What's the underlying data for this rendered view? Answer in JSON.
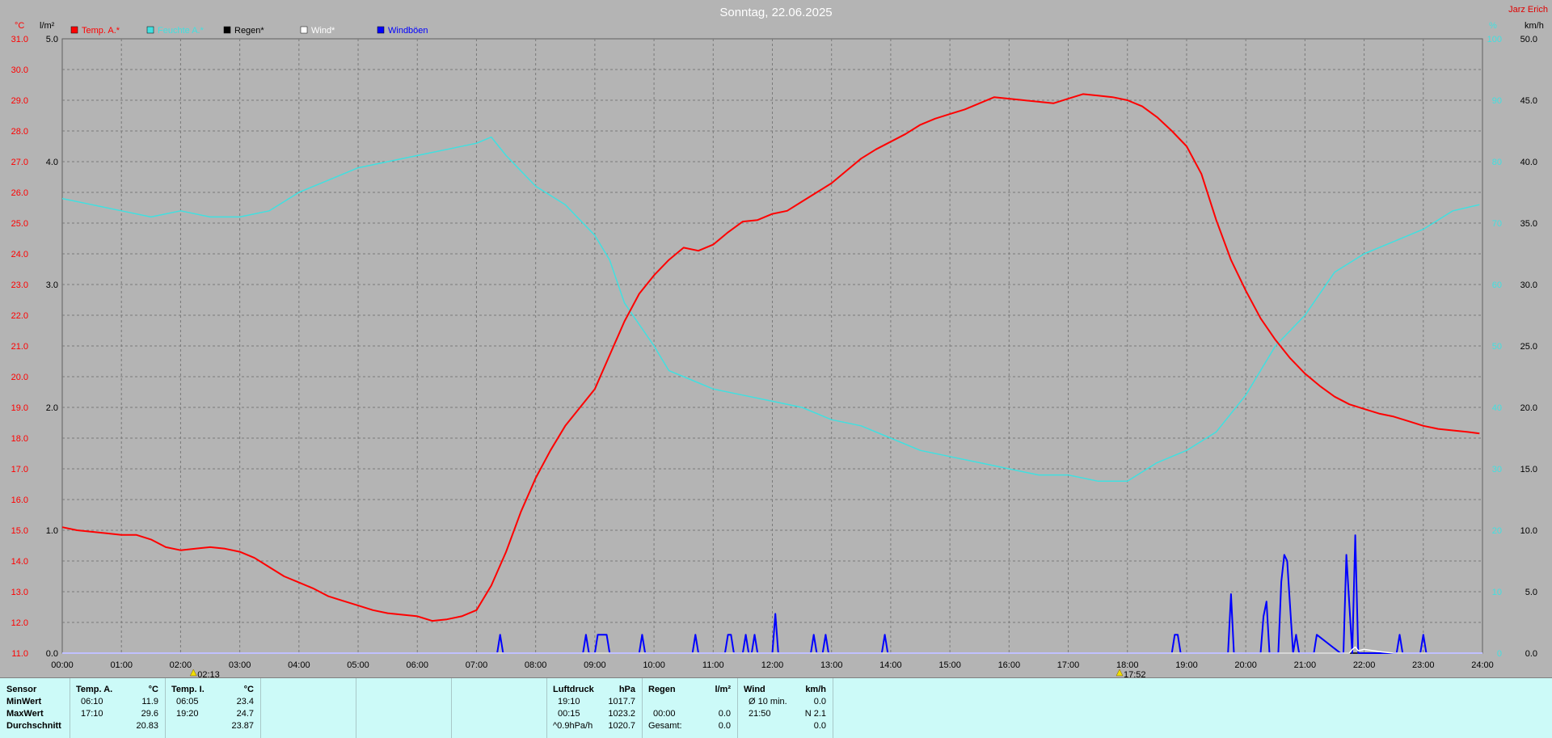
{
  "header": {
    "title": "Sonntag, 22.06.2025",
    "author": "Jarz Erich"
  },
  "axes": {
    "left1_unit": "°C",
    "left2_unit": "l/m²",
    "right1_unit": "%",
    "right2_unit": "km/h",
    "temp_ticks": [
      "31.0",
      "30.0",
      "29.0",
      "28.0",
      "27.0",
      "26.0",
      "25.0",
      "24.0",
      "23.0",
      "22.0",
      "21.0",
      "20.0",
      "19.0",
      "18.0",
      "17.0",
      "16.0",
      "15.0",
      "14.0",
      "13.0",
      "12.0",
      "11.0"
    ],
    "rain_ticks": [
      "5.0",
      "4.0",
      "3.0",
      "2.0",
      "1.0",
      "0.0"
    ],
    "hum_ticks": [
      "100",
      "90",
      "80",
      "70",
      "60",
      "50",
      "40",
      "30",
      "20",
      "10",
      "0"
    ],
    "wind_ticks": [
      "50.0",
      "45.0",
      "40.0",
      "35.0",
      "30.0",
      "25.0",
      "20.0",
      "15.0",
      "10.0",
      "5.0",
      "0.0"
    ],
    "x_ticks": [
      "00:00",
      "01:00",
      "02:00",
      "03:00",
      "04:00",
      "05:00",
      "06:00",
      "07:00",
      "08:00",
      "09:00",
      "10:00",
      "11:00",
      "12:00",
      "13:00",
      "14:00",
      "15:00",
      "16:00",
      "17:00",
      "18:00",
      "19:00",
      "20:00",
      "21:00",
      "22:00",
      "23:00",
      "24:00"
    ],
    "sunrise": "02:13",
    "sunset": "17:52"
  },
  "legend": [
    {
      "label": "Temp. A.*",
      "color": "#ff0000"
    },
    {
      "label": "Feuchte A.*",
      "color": "#40e0e0"
    },
    {
      "label": "Regen*",
      "color": "#000000"
    },
    {
      "label": "Wind*",
      "color": "#ffffff"
    },
    {
      "label": "Windböen",
      "color": "#0000ff"
    }
  ],
  "chart_data": {
    "type": "line",
    "x_range": [
      0,
      24
    ],
    "series": [
      {
        "name": "Temp. A.*",
        "color": "#ff0000",
        "axis": "°C",
        "ylim": [
          11,
          31
        ],
        "x": [
          0,
          0.25,
          0.5,
          0.75,
          1.0,
          1.25,
          1.5,
          1.75,
          2.0,
          2.25,
          2.5,
          2.75,
          3.0,
          3.25,
          3.5,
          3.75,
          4.0,
          4.25,
          4.5,
          4.75,
          5.0,
          5.25,
          5.5,
          5.75,
          6.0,
          6.25,
          6.5,
          6.75,
          7.0,
          7.25,
          7.5,
          7.75,
          8.0,
          8.25,
          8.5,
          8.75,
          9.0,
          9.25,
          9.5,
          9.75,
          10.0,
          10.25,
          10.5,
          10.75,
          11.0,
          11.25,
          11.5,
          11.75,
          12.0,
          12.25,
          12.5,
          12.75,
          13.0,
          13.25,
          13.5,
          13.75,
          14.0,
          14.25,
          14.5,
          14.75,
          15.0,
          15.25,
          15.5,
          15.75,
          16.0,
          16.25,
          16.5,
          16.75,
          17.0,
          17.25,
          17.5,
          17.75,
          18.0,
          18.25,
          18.5,
          18.75,
          19.0,
          19.25,
          19.5,
          19.75,
          20.0,
          20.25,
          20.5,
          20.75,
          21.0,
          21.25,
          21.5,
          21.75,
          22.0,
          22.25,
          22.5,
          22.75,
          23.0,
          23.25,
          23.5,
          23.75,
          23.95
        ],
        "y": [
          15.1,
          15.0,
          14.95,
          14.9,
          14.85,
          14.85,
          14.7,
          14.45,
          14.35,
          14.4,
          14.45,
          14.4,
          14.3,
          14.1,
          13.8,
          13.5,
          13.3,
          13.1,
          12.85,
          12.7,
          12.55,
          12.4,
          12.3,
          12.25,
          12.2,
          12.05,
          12.1,
          12.2,
          12.4,
          13.2,
          14.3,
          15.6,
          16.7,
          17.6,
          18.4,
          19.0,
          19.6,
          20.7,
          21.8,
          22.7,
          23.3,
          23.8,
          24.2,
          24.1,
          24.3,
          24.7,
          25.05,
          25.1,
          25.3,
          25.4,
          25.7,
          26.0,
          26.3,
          26.7,
          27.1,
          27.4,
          27.65,
          27.9,
          28.2,
          28.4,
          28.55,
          28.7,
          28.9,
          29.1,
          29.05,
          29.0,
          28.95,
          28.9,
          29.05,
          29.2,
          29.15,
          29.1,
          29.0,
          28.8,
          28.45,
          28.0,
          27.5,
          26.6,
          25.1,
          23.8,
          22.8,
          21.9,
          21.2,
          20.6,
          20.1,
          19.7,
          19.35,
          19.1,
          18.95,
          18.8,
          18.7,
          18.55,
          18.4,
          18.3,
          18.25,
          18.2,
          18.15
        ]
      },
      {
        "name": "Feuchte A.*",
        "color": "#40e0e0",
        "axis": "%",
        "ylim": [
          0,
          100
        ],
        "x": [
          0,
          0.5,
          1.0,
          1.5,
          2.0,
          2.5,
          3.0,
          3.5,
          4.0,
          4.5,
          5.0,
          5.5,
          6.0,
          6.5,
          7.0,
          7.25,
          7.5,
          8.0,
          8.5,
          9.0,
          9.25,
          9.5,
          10.0,
          10.25,
          10.5,
          11.0,
          11.5,
          12.0,
          12.5,
          13.0,
          13.5,
          14.0,
          14.5,
          15.0,
          15.5,
          16.0,
          16.5,
          17.0,
          17.5,
          18.0,
          18.5,
          19.0,
          19.5,
          20.0,
          20.5,
          21.0,
          21.5,
          22.0,
          22.5,
          23.0,
          23.5,
          23.95
        ],
        "y": [
          74,
          73,
          72,
          71,
          72,
          71,
          71,
          72,
          75,
          77,
          79,
          80,
          81,
          82,
          83,
          84,
          81,
          76,
          73,
          68,
          64,
          57,
          50,
          46,
          45,
          43,
          42,
          41,
          40,
          38,
          37,
          35,
          33,
          32,
          31,
          30,
          29,
          29,
          28,
          28,
          31,
          33,
          36,
          42,
          50,
          55,
          62,
          65,
          67,
          69,
          72,
          73
        ]
      },
      {
        "name": "Regen*",
        "color": "#000000",
        "axis": "l/m²",
        "ylim": [
          0,
          5
        ],
        "x": [
          0,
          24
        ],
        "y": [
          0,
          0
        ]
      },
      {
        "name": "Wind*",
        "color": "#ffffff",
        "axis": "km/h",
        "ylim": [
          0,
          50
        ],
        "x": [
          0,
          21.7,
          21.75,
          21.8,
          21.85,
          21.9,
          22.0,
          22.3,
          22.5,
          24
        ],
        "y": [
          0,
          0,
          0,
          0.3,
          0.5,
          0.2,
          0.3,
          0.1,
          0,
          0
        ]
      },
      {
        "name": "Windböen",
        "color": "#0000ff",
        "axis": "km/h",
        "ylim": [
          0,
          50
        ],
        "x": [
          0,
          7.35,
          7.4,
          7.45,
          8.8,
          8.85,
          8.9,
          9.0,
          9.05,
          9.15,
          9.2,
          9.25,
          9.75,
          9.8,
          9.85,
          10.65,
          10.7,
          10.75,
          11.2,
          11.25,
          11.3,
          11.35,
          11.5,
          11.55,
          11.6,
          11.65,
          11.7,
          11.75,
          12.0,
          12.05,
          12.1,
          12.65,
          12.7,
          12.75,
          12.85,
          12.9,
          12.95,
          13.85,
          13.9,
          13.95,
          18.75,
          18.8,
          18.85,
          18.9,
          19.7,
          19.75,
          19.8,
          20.25,
          20.3,
          20.35,
          20.4,
          20.55,
          20.6,
          20.65,
          20.7,
          20.8,
          20.85,
          20.9,
          21.15,
          21.2,
          21.6,
          21.65,
          21.7,
          21.8,
          21.85,
          21.9,
          22.0,
          22.55,
          22.6,
          22.65,
          22.95,
          23.0,
          23.05,
          24
        ],
        "y": [
          0,
          0,
          1.5,
          0,
          0,
          1.5,
          0,
          0,
          1.5,
          1.5,
          1.5,
          0,
          0,
          1.5,
          0,
          0,
          1.5,
          0,
          0,
          1.5,
          1.5,
          0,
          0,
          1.5,
          0,
          0,
          1.5,
          0,
          0,
          3.2,
          0,
          0,
          1.5,
          0,
          0,
          1.5,
          0,
          0,
          1.5,
          0,
          0,
          1.5,
          1.5,
          0,
          0,
          4.8,
          0,
          0,
          3.0,
          4.2,
          0,
          0,
          5.8,
          8.0,
          7.5,
          0,
          1.5,
          0,
          0,
          1.5,
          0,
          0,
          8.0,
          0,
          9.6,
          0,
          0,
          0,
          1.5,
          0,
          0,
          1.5,
          0,
          0
        ]
      }
    ]
  },
  "stats": {
    "sensor": {
      "header": "Sensor",
      "rows": [
        "MinWert",
        "MaxWert",
        "Durchschnitt"
      ]
    },
    "temp_a": {
      "header": "Temp. A.",
      "unit": "°C",
      "rows": [
        [
          "06:10",
          "11.9"
        ],
        [
          "17:10",
          "29.6"
        ],
        [
          "",
          "20.83"
        ]
      ]
    },
    "temp_i": {
      "header": "Temp. I.",
      "unit": "°C",
      "rows": [
        [
          "06:05",
          "23.4"
        ],
        [
          "19:20",
          "24.7"
        ],
        [
          "",
          "23.87"
        ]
      ]
    },
    "luftdruck": {
      "header": "Luftdruck",
      "unit": "hPa",
      "rows": [
        [
          "19:10",
          "1017.7"
        ],
        [
          "00:15",
          "1023.2"
        ],
        [
          "^0.9hPa/h",
          "1020.7"
        ]
      ]
    },
    "regen": {
      "header": "Regen",
      "unit": "l/m²",
      "rows": [
        [
          "",
          ""
        ],
        [
          "00:00",
          "0.0"
        ],
        [
          "Gesamt:",
          "0.0"
        ]
      ]
    },
    "wind": {
      "header": "Wind",
      "unit": "km/h",
      "rows": [
        [
          "Ø 10 min.",
          "0.0"
        ],
        [
          "21:50",
          "N 2.1"
        ],
        [
          "",
          "0.0"
        ]
      ]
    }
  }
}
